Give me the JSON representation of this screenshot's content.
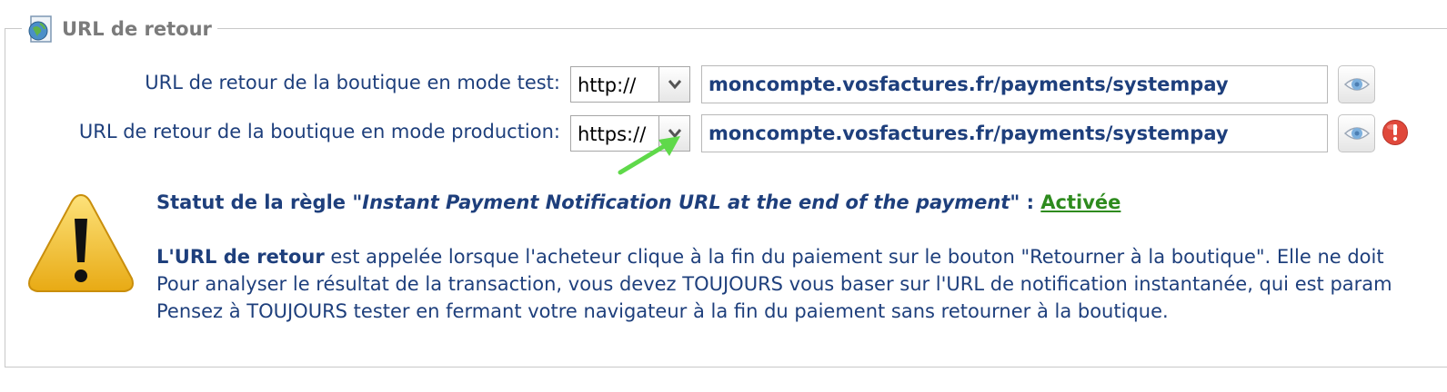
{
  "section": {
    "title": "URL de retour",
    "icon": "globe-page-icon"
  },
  "rows": [
    {
      "label": "URL de retour de la boutique en mode test:",
      "protocol": "http://",
      "url": "moncompte.vosfactures.fr/payments/systempay",
      "eye_icon": "eye-icon"
    },
    {
      "label": "URL de retour de la boutique en mode production:",
      "protocol": "https://",
      "url": "moncompte.vosfactures.fr/payments/systempay",
      "eye_icon": "eye-icon",
      "status_icon": "error-icon"
    }
  ],
  "status": {
    "prefix": "Statut de la règle \"",
    "rule_name": "Instant Payment Notification URL at the end of the payment",
    "suffix": "\" : ",
    "value": "Activée "
  },
  "info": {
    "line1_bold": "L'URL de retour",
    "line1_rest": " est appelée lorsque l'acheteur clique à la fin du paiement sur le bouton \"Retourner à la boutique\". Elle ne doit",
    "line2": "Pour analyser le résultat de la transaction, vous devez TOUJOURS vous baser sur l'URL de notification instantanée, qui est param",
    "line3": "Pensez à TOUJOURS tester en fermant votre navigateur à la fin du paiement sans retourner à la boutique."
  },
  "colors": {
    "label_text": "#1e3f7c",
    "status_active": "#2e8b1e",
    "legend_text": "#7b7b7b",
    "annotation_arrow": "#5fd94a",
    "warning_yellow": "#f2c12e",
    "error_red": "#e0483b"
  }
}
